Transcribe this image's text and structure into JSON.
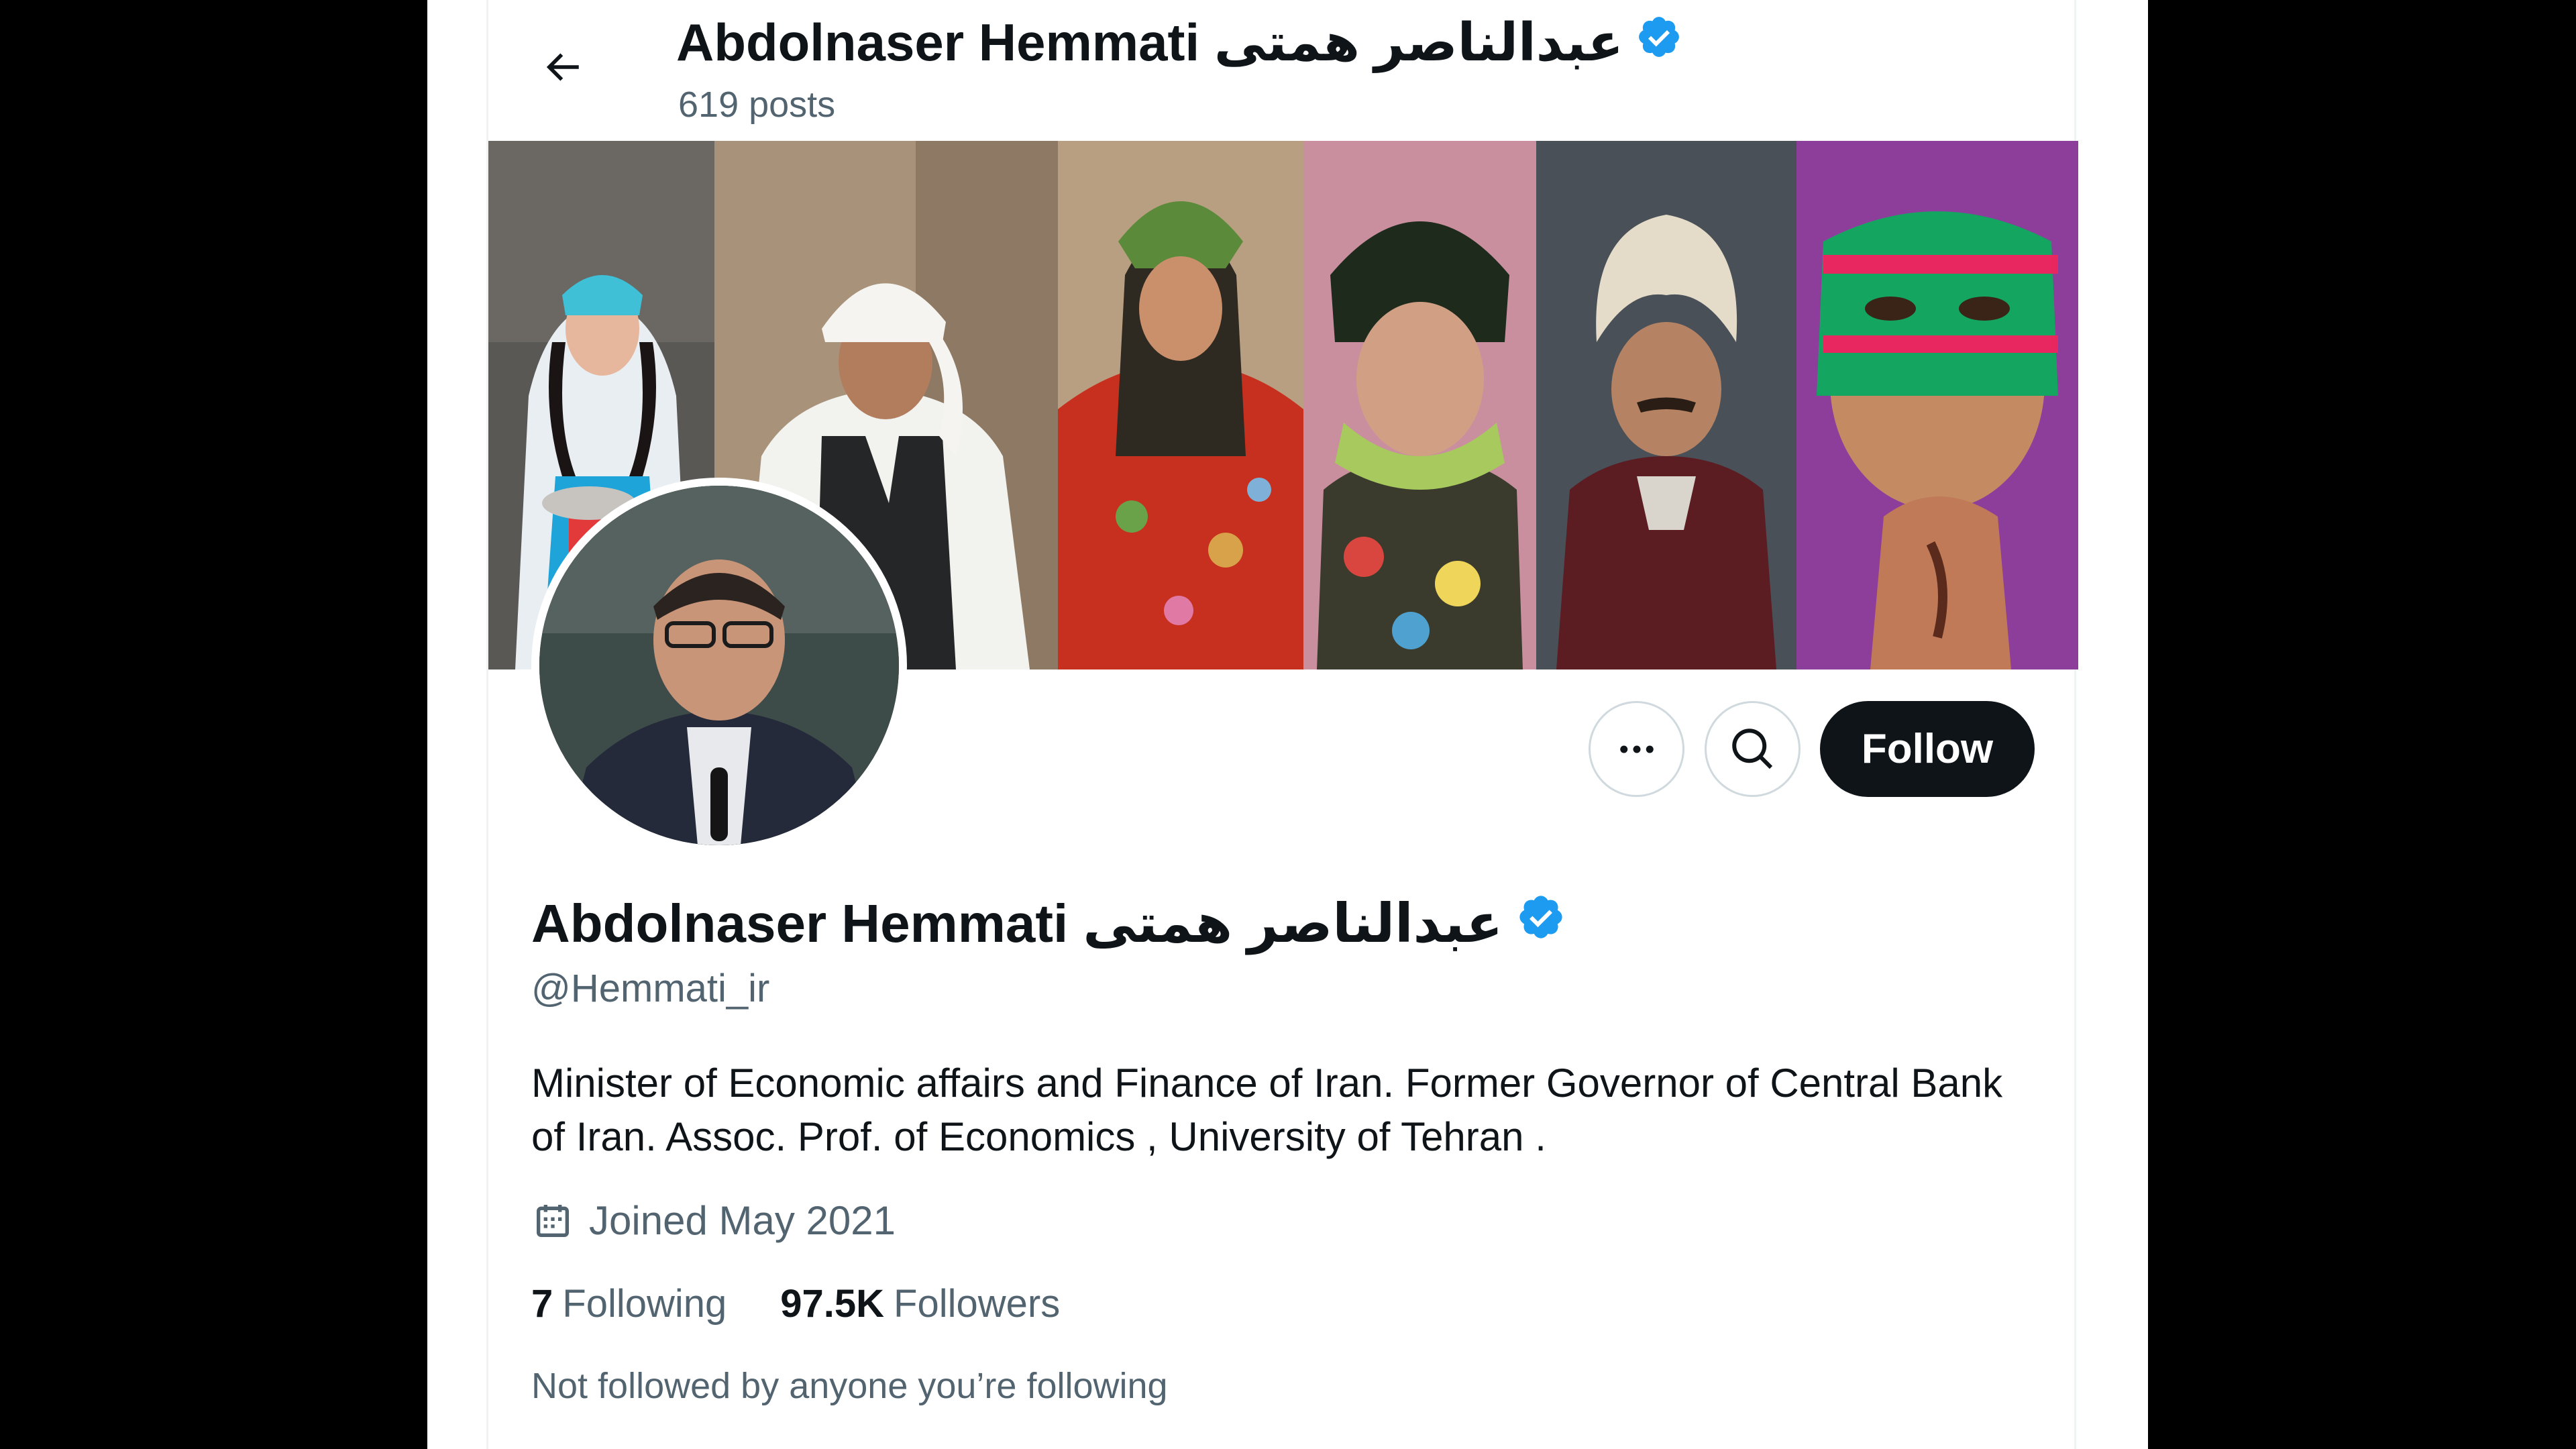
{
  "header": {
    "title": "Abdolnaser Hemmati عبدالناصر همتی",
    "posts_count": "619 posts"
  },
  "profile": {
    "display_name": "Abdolnaser Hemmati عبدالناصر همتی",
    "handle": "@Hemmati_ir",
    "bio": "Minister of Economic affairs and Finance of Iran. Former Governor of Central Bank of Iran. Assoc. Prof. of Economics , University of Tehran .",
    "joined": "Joined May 2021",
    "following_count": "7",
    "following_label": "Following",
    "followers_count": "97.5K",
    "followers_label": "Followers",
    "not_followed_text": "Not followed by anyone you’re following"
  },
  "actions": {
    "follow_label": "Follow",
    "more_icon": "more-horizontal-icon",
    "search_icon": "search-icon"
  },
  "colors": {
    "text_primary": "#0f1419",
    "text_secondary": "#536471",
    "verified": "#1d9bf0",
    "follow_bg": "#0f1419",
    "border": "#cfd9de"
  }
}
